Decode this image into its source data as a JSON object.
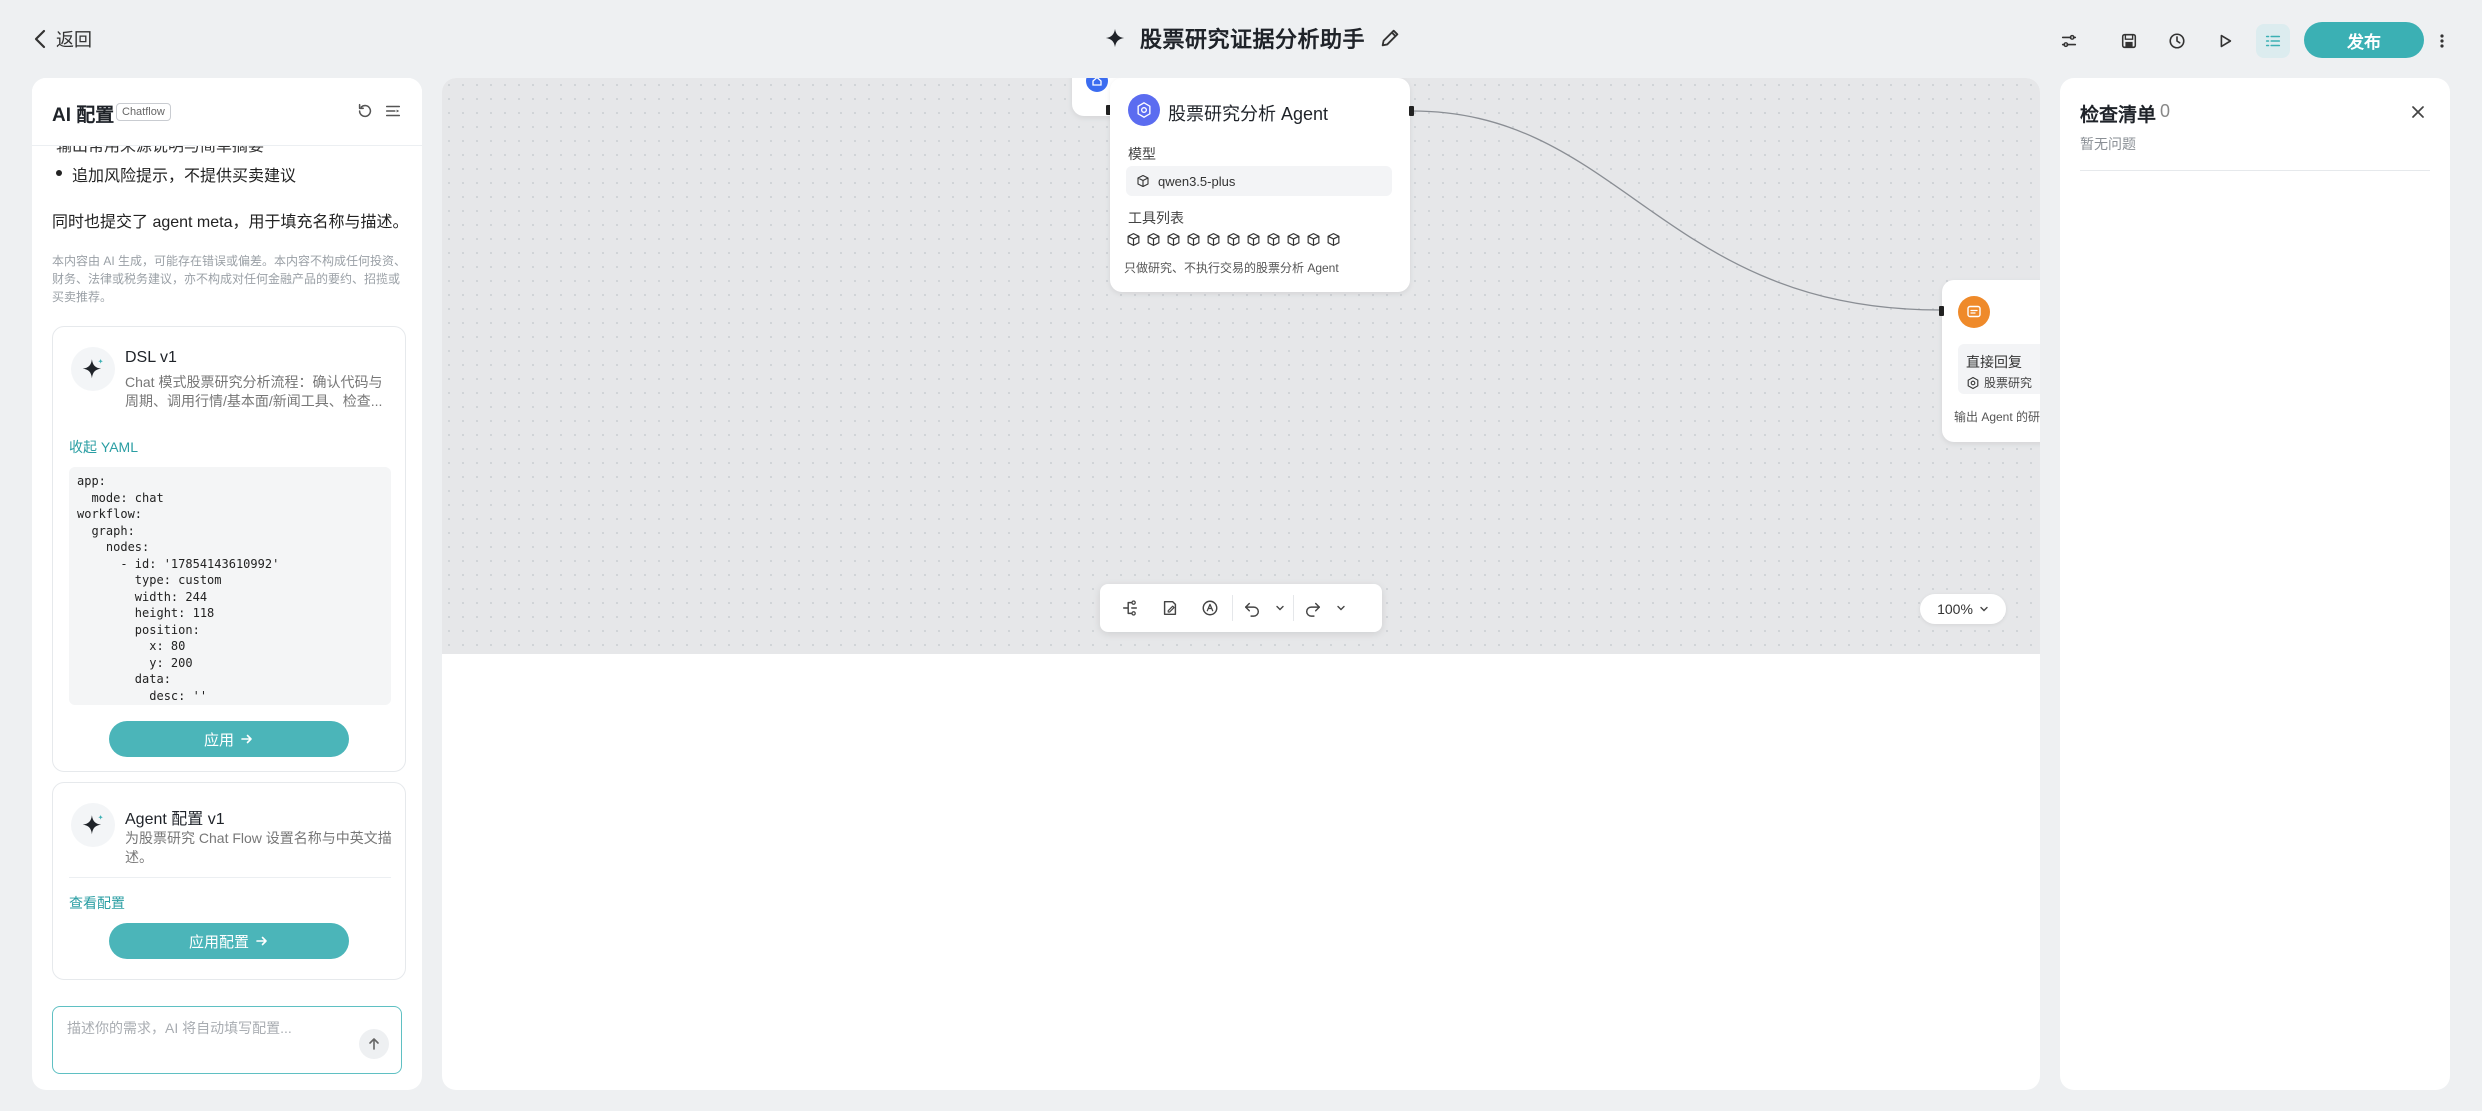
{
  "header": {
    "back_label": "返回",
    "title": "股票研究证据分析助手",
    "publish_label": "发布"
  },
  "left_panel": {
    "title": "AI 配置",
    "tag": "Chatflow",
    "cut_line": "输出常用来源说明与简单摘要",
    "bullet": "追加风险提示，不提供买卖建议",
    "paragraph": "同时也提交了 agent meta，用于填充名称与描述。",
    "disclaimer": "本内容由 AI 生成，可能存在错误或偏差。本内容不构成任何投资、财务、法律或税务建议，亦不构成对任何金融产品的要约、招揽或买卖推荐。",
    "dsl_card": {
      "title": "DSL v1",
      "desc": "Chat 模式股票研究分析流程：确认代码与周期、调用行情/基本面/新闻工具、检查...",
      "link": "收起 YAML",
      "yaml": "app:\n  mode: chat\nworkflow:\n  graph:\n    nodes:\n      - id: '17854143610992'\n        type: custom\n        width: 244\n        height: 118\n        position:\n          x: 80\n          y: 200\n        data:\n          desc: ''",
      "apply_label": "应用"
    },
    "agent_card": {
      "title": "Agent 配置 v1",
      "desc": "为股票研究 Chat Flow 设置名称与中英文描述。",
      "link": "查看配置",
      "apply_label": "应用配置"
    },
    "input_placeholder": "描述你的需求，AI 将自动填写配置..."
  },
  "canvas": {
    "agent_node": {
      "title": "股票研究分析 Agent",
      "model_label": "模型",
      "model_value": "qwen3.5-plus",
      "tools_label": "工具列表",
      "tool_count": 11,
      "desc": "只做研究、不执行交易的股票分析 Agent"
    },
    "reply_node": {
      "title": "直接回复",
      "ref": "股票研究",
      "desc": "输出 Agent 的研"
    },
    "zoom": "100%"
  },
  "right_panel": {
    "title": "检查清单",
    "count": "0",
    "empty": "暂无问题"
  },
  "colors": {
    "accent": "#3bb0b4",
    "agent_icon": "#5b6cf0",
    "reply_icon": "#ef8a2a",
    "start_icon": "#3b6cf0"
  }
}
